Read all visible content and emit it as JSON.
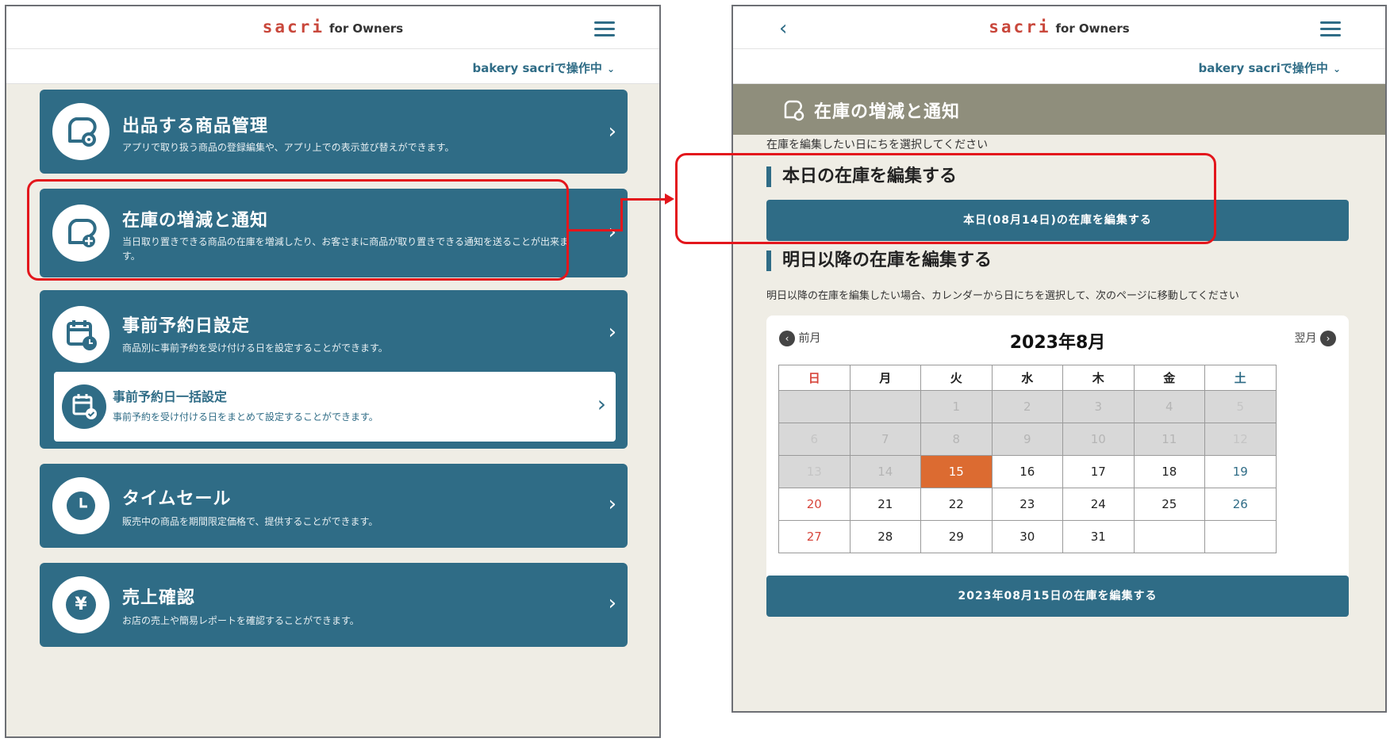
{
  "brand": {
    "name": "sacri",
    "suffix": "for Owners"
  },
  "store_selector": {
    "label": "bakery sacriで操作中"
  },
  "left": {
    "cards": [
      {
        "title": "出品する商品管理",
        "desc": "アプリで取り扱う商品の登録編集や、アプリ上での表示並び替えができます。",
        "icon": "bread-gear-icon"
      },
      {
        "title": "在庫の増減と通知",
        "desc": "当日取り置きできる商品の在庫を増減したり、お客さまに商品が取り置きできる通知を送ることが出来ます。",
        "icon": "bread-plus-icon"
      },
      {
        "title": "事前予約日設定",
        "desc": "商品別に事前予約を受け付ける日を設定することができます。",
        "icon": "calendar-clock-icon"
      },
      {
        "title": "タイムセール",
        "desc": "販売中の商品を期間限定価格で、提供することができます。",
        "icon": "clock-icon"
      },
      {
        "title": "売上確認",
        "desc": "お店の売上や簡易レポートを確認することができます。",
        "icon": "yen-icon"
      }
    ],
    "subcard": {
      "title": "事前予約日一括設定",
      "desc": "事前予約を受け付ける日をまとめて設定することができます。",
      "icon": "calendar-check-icon"
    },
    "yen_glyph": "¥"
  },
  "right": {
    "section_title": "在庫の増減と通知",
    "instruction": "在庫を編集したい日にちを選択してください",
    "today_heading": "本日の在庫を編集する",
    "today_button": "本日(08月14日)の在庫を編集する",
    "future_heading": "明日以降の在庫を編集する",
    "future_instruction": "明日以降の在庫を編集したい場合、カレンダーから日にちを選択して、次のページに移動してください",
    "calendar": {
      "prev_label": "前月",
      "next_label": "翌月",
      "title": "2023年8月",
      "weekdays": [
        "日",
        "月",
        "火",
        "水",
        "木",
        "金",
        "土"
      ],
      "rows": [
        [
          "",
          "",
          "1",
          "2",
          "3",
          "4",
          "5"
        ],
        [
          "6",
          "7",
          "8",
          "9",
          "10",
          "11",
          "12"
        ],
        [
          "13",
          "14",
          "15",
          "16",
          "17",
          "18",
          "19"
        ],
        [
          "20",
          "21",
          "22",
          "23",
          "24",
          "25",
          "26"
        ],
        [
          "27",
          "28",
          "29",
          "30",
          "31",
          "",
          ""
        ]
      ],
      "past_days": [
        "1",
        "2",
        "3",
        "4",
        "5",
        "6",
        "7",
        "8",
        "9",
        "10",
        "11",
        "12",
        "13",
        "14"
      ],
      "selected_day": "15"
    },
    "submit_button": "2023年08月15日の在庫を編集する"
  },
  "colors": {
    "primary": "#2f6c86",
    "accent_red": "#e3161c",
    "selected": "#dc6b31",
    "header_band": "#8f8e7c"
  }
}
